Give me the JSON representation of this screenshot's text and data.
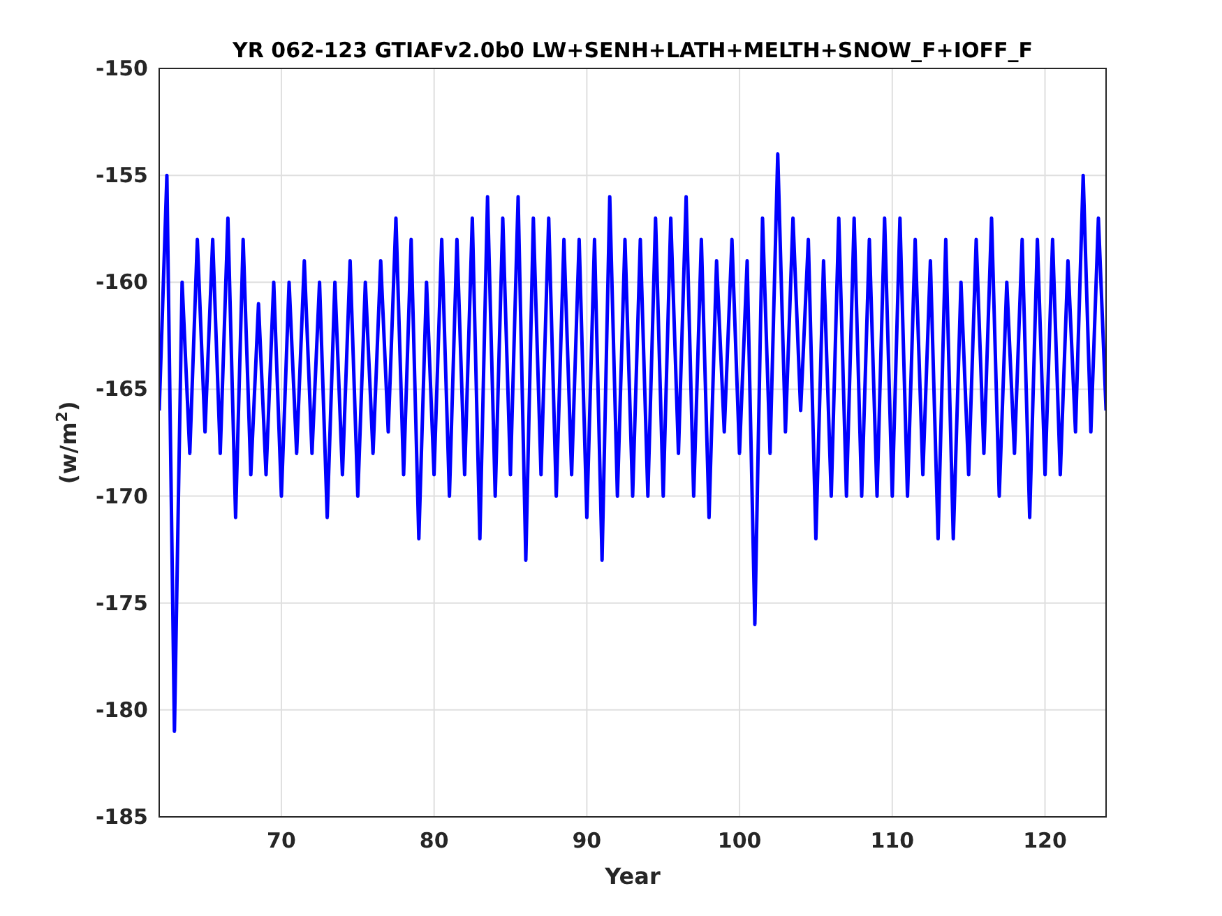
{
  "figure": {
    "chart_data": {
      "type": "line",
      "title": "YR 062-123 GTIAFv2.0b0 LW+SENH+LATH+MELTH+SNOW_F+IOFF_F",
      "xlabel": "Year",
      "ylabel": "(w/m$^{2}$)",
      "xlim": [
        62,
        124
      ],
      "ylim": [
        -185,
        -150
      ],
      "xticks": [
        70,
        80,
        90,
        100,
        110,
        120
      ],
      "yticks": [
        -185,
        -180,
        -175,
        -170,
        -165,
        -160,
        -155,
        -150
      ],
      "x": [
        62,
        62.5,
        63,
        63.5,
        64,
        64.5,
        65,
        65.5,
        66,
        66.5,
        67,
        67.5,
        68,
        68.5,
        69,
        69.5,
        70,
        70.5,
        71,
        71.5,
        72,
        72.5,
        73,
        73.5,
        74,
        74.5,
        75,
        75.5,
        76,
        76.5,
        77,
        77.5,
        78,
        78.5,
        79,
        79.5,
        80,
        80.5,
        81,
        81.5,
        82,
        82.5,
        83,
        83.5,
        84,
        84.5,
        85,
        85.5,
        86,
        86.5,
        87,
        87.5,
        88,
        88.5,
        89,
        89.5,
        90,
        90.5,
        91,
        91.5,
        92,
        92.5,
        93,
        93.5,
        94,
        94.5,
        95,
        95.5,
        96,
        96.5,
        97,
        97.5,
        98,
        98.5,
        99,
        99.5,
        100,
        100.5,
        101,
        101.5,
        102,
        102.5,
        103,
        103.5,
        104,
        104.5,
        105,
        105.5,
        106,
        106.5,
        107,
        107.5,
        108,
        108.5,
        109,
        109.5,
        110,
        110.5,
        111,
        111.5,
        112,
        112.5,
        113,
        113.5,
        114,
        114.5,
        115,
        115.5,
        116,
        116.5,
        117,
        117.5,
        118,
        118.5,
        119,
        119.5,
        120,
        120.5,
        121,
        121.5,
        122,
        122.5,
        123,
        123.5,
        124
      ],
      "grid": true,
      "series": [
        {
          "color": "#0000ff",
          "values": [
            -166,
            -155,
            -181,
            -160,
            -168,
            -158,
            -167,
            -158,
            -168,
            -157,
            -171,
            -158,
            -169,
            -161,
            -169,
            -160,
            -170,
            -160,
            -168,
            -159,
            -168,
            -160,
            -171,
            -160,
            -169,
            -159,
            -170,
            -160,
            -168,
            -159,
            -167,
            -157,
            -169,
            -158,
            -172,
            -160,
            -169,
            -158,
            -170,
            -158,
            -169,
            -157,
            -172,
            -156,
            -170,
            -157,
            -169,
            -156,
            -173,
            -157,
            -169,
            -157,
            -170,
            -158,
            -169,
            -158,
            -171,
            -158,
            -173,
            -156,
            -170,
            -158,
            -170,
            -158,
            -170,
            -157,
            -170,
            -157,
            -168,
            -156,
            -170,
            -158,
            -171,
            -159,
            -167,
            -158,
            -168,
            -159,
            -176,
            -157,
            -168,
            -154,
            -167,
            -157,
            -166,
            -158,
            -172,
            -159,
            -170,
            -157,
            -170,
            -157,
            -170,
            -158,
            -170,
            -157,
            -170,
            -157,
            -170,
            -158,
            -169,
            -159,
            -172,
            -158,
            -172,
            -160,
            -169,
            -158,
            -168,
            -157,
            -170,
            -160,
            -168,
            -158,
            -171,
            -158,
            -169,
            -158,
            -169,
            -159,
            -167,
            -155,
            -167,
            -157,
            -166
          ]
        }
      ]
    }
  }
}
